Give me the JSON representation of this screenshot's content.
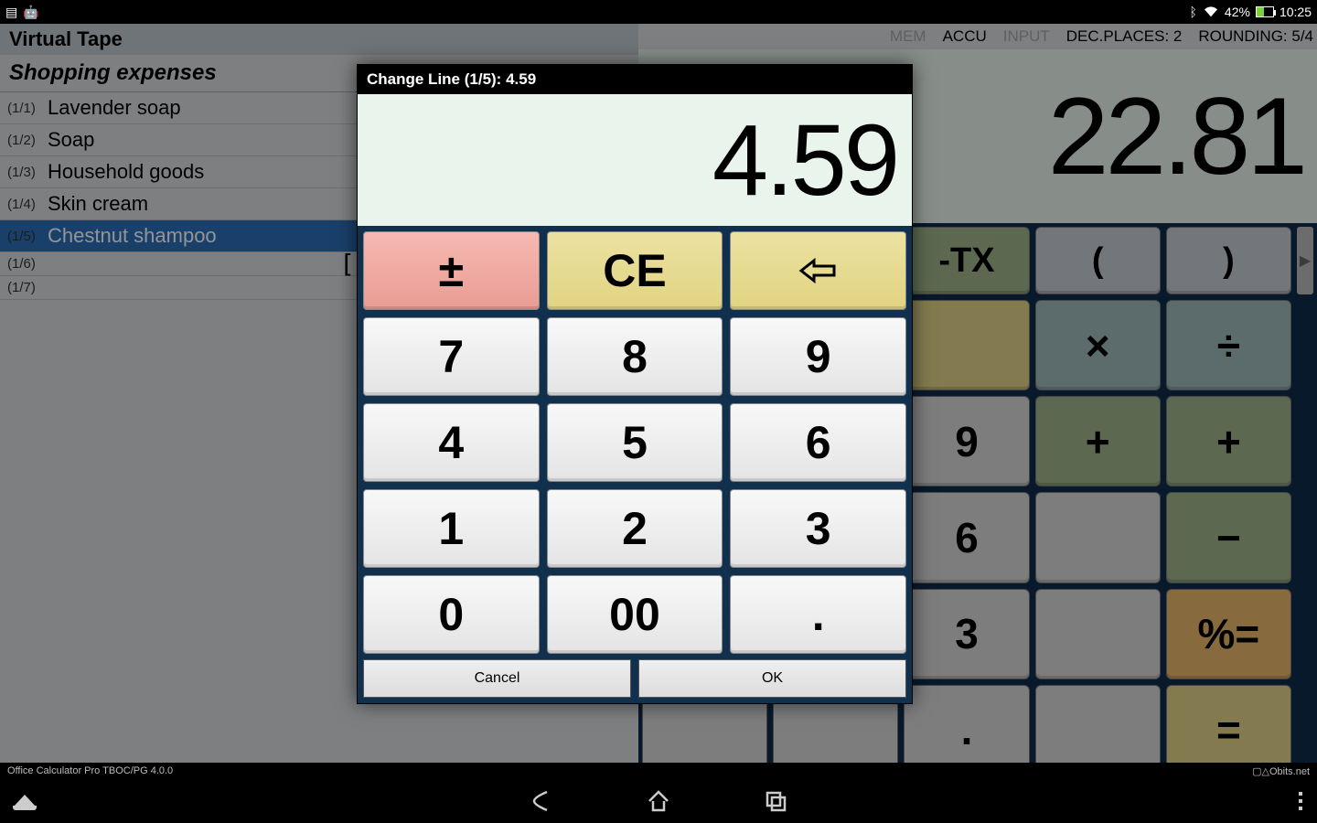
{
  "statusbar": {
    "battery_pct": "42%",
    "time": "10:25",
    "bt_icon": "bluetooth",
    "wifi_icon": "wifi"
  },
  "tape": {
    "title": "Virtual Tape",
    "subtitle": "Shopping expenses",
    "rows": [
      {
        "ix": "(1/1)",
        "label": "Lavender soap"
      },
      {
        "ix": "(1/2)",
        "label": "Soap"
      },
      {
        "ix": "(1/3)",
        "label": "Household goods"
      },
      {
        "ix": "(1/4)",
        "label": "Skin cream"
      },
      {
        "ix": "(1/5)",
        "label": "Chestnut shampoo",
        "selected": true
      },
      {
        "ix": "(1/6)",
        "label": "",
        "bracket": "["
      },
      {
        "ix": "(1/7)",
        "label": ""
      }
    ]
  },
  "calc": {
    "status": {
      "mem": "MEM",
      "accu": "ACCU",
      "input": "INPUT",
      "dec": "DEC.PLACES: 2",
      "round": "ROUNDING: 5/4"
    },
    "display": "22.81",
    "row0": [
      "",
      "",
      "-TX",
      "(",
      ")"
    ],
    "grid": [
      [
        "",
        "",
        "",
        "×",
        "÷"
      ],
      [
        "",
        "",
        "9",
        "",
        "+"
      ],
      [
        "",
        "",
        "6",
        "",
        "−"
      ],
      [
        "",
        "",
        "3",
        "",
        "%="
      ],
      [
        "",
        "",
        ".",
        "",
        "="
      ]
    ]
  },
  "dialog": {
    "title": "Change Line (1/5): 4.59",
    "display": "4.59",
    "top": [
      "±",
      "CE",
      "⇦"
    ],
    "nums": [
      [
        "7",
        "8",
        "9"
      ],
      [
        "4",
        "5",
        "6"
      ],
      [
        "1",
        "2",
        "3"
      ],
      [
        "0",
        "00",
        "."
      ]
    ],
    "cancel": "Cancel",
    "ok": "OK"
  },
  "footer": {
    "left": "Office Calculator Pro  TBOC/PG 4.0.0",
    "right": "▢△Obits.net"
  }
}
